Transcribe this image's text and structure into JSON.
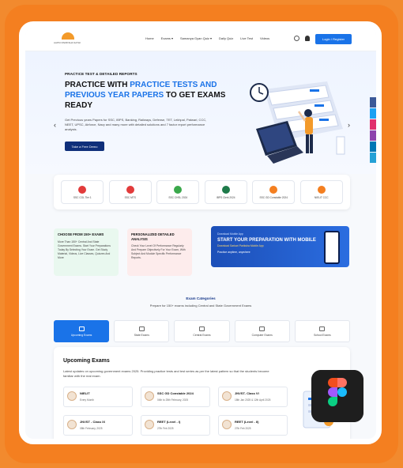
{
  "brand": {
    "logo_text": "AAPKI PARIKSHA SATHI"
  },
  "nav": {
    "links": [
      "Home",
      "Exams ▾",
      "Samanya Gyan Quiz ▾",
      "Daily Quiz",
      "Live Test",
      "Videos"
    ],
    "login_label": "Login / Register"
  },
  "hero": {
    "eyebrow": "PRACTICE TEST & DETAILED REPORTS",
    "title_a": "PRACTICE WITH ",
    "title_b": "PRACTICE TESTS AND PREVIOUS YEAR PAPERS",
    "title_c": " TO GET EXAMS READY",
    "description": "Get Previous years Papers for SSC, IBPS, Banking, Railways, Defense, TET, Lekhpal, Patwari, CCC, NEET, UPSC, Airforce, Navy and many more with detailed solutions and 7 factor report performance analysis.",
    "demo_label": "Take a Free Demo",
    "left_arrow": "‹",
    "right_arrow": "›"
  },
  "exam_chips": [
    {
      "label": "SSC CGL Tier 1",
      "color": "#e23b3b"
    },
    {
      "label": "SSC MTS",
      "color": "#e23b3b"
    },
    {
      "label": "SSC CHSL 2024",
      "color": "#3aa84b"
    },
    {
      "label": "IBPS Clerk 2024",
      "color": "#1e7a4a"
    },
    {
      "label": "SSC GD Constable 2024",
      "color": "#f47f20"
    },
    {
      "label": "NIELIT CCC",
      "color": "#f47f20"
    }
  ],
  "features": [
    {
      "title": "CHOOSE FROM 150+ EXAMS",
      "body": "More Than 150+ Central And State Government Exams. Start Your Preparations Today By Selecting Your Exam. Get Study Material, Videos, Live Classes, Quizzes And More",
      "bg": "#e9f8ef"
    },
    {
      "title": "PERSONALIZED DETAILED ANALYSIS",
      "body": "Check Your Level Of Performance Regularly And Prepare Objectively For Your Exam, With Subject And Module Specific Performance Reports.",
      "bg": "#fdecec"
    }
  ],
  "app_banner": {
    "line1": "Download Mobile App",
    "line2": "START YOUR PREPARATION WITH MOBILE",
    "line3": "Download Sarkari Pariksha Mobile App",
    "line4": "Practice anytime, anywhere"
  },
  "categories": {
    "heading": "Exam Categories",
    "subheading": "Prepare for 150+ exams including Central and State Government Exams",
    "tabs": [
      "Upcoming Exams",
      "State Exams",
      "Central Exams",
      "Computer Exams",
      "School Exams"
    ]
  },
  "upcoming": {
    "title": "Upcoming Exams",
    "description": "Latest updates on upcoming government exams 2025. Providing practice tests and test series as per the latest pattern so that the students become familiar with the real exam.",
    "exams": [
      {
        "name": "NIELIT",
        "date": "Every Month"
      },
      {
        "name": "SSC GD Constable 2024",
        "date": "04th to 25th February, 2025"
      },
      {
        "name": "JNVST- Class VI",
        "date": "18th Jan 2025 & 12th April 2025"
      },
      {
        "name": "JNVST - Class IX",
        "date": "08th February, 2025"
      },
      {
        "name": "REET (Level - I)",
        "date": "27th Feb 2025"
      },
      {
        "name": "REET (Level - II)",
        "date": "27th Feb 2025"
      }
    ]
  }
}
